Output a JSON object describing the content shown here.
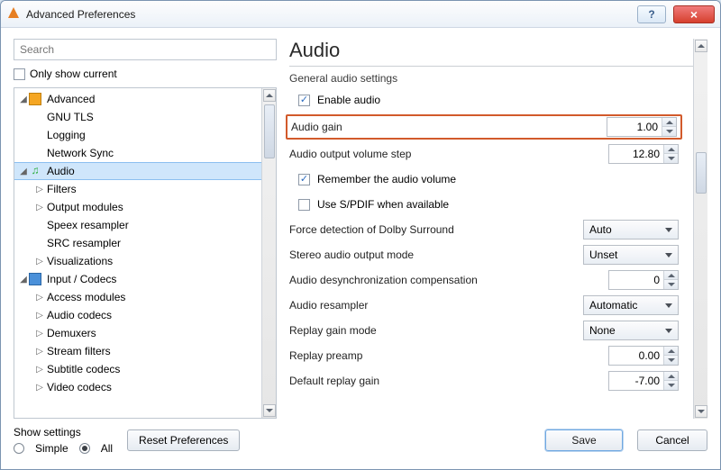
{
  "window": {
    "title": "Advanced Preferences"
  },
  "search": {
    "placeholder": "Search"
  },
  "only_current": {
    "label": "Only show current"
  },
  "tree": {
    "advanced": "Advanced",
    "gnu_tls": "GNU TLS",
    "logging": "Logging",
    "network_sync": "Network Sync",
    "audio": "Audio",
    "filters": "Filters",
    "output_modules": "Output modules",
    "speex": "Speex resampler",
    "src": "SRC resampler",
    "visualizations": "Visualizations",
    "input_codecs": "Input / Codecs",
    "access_modules": "Access modules",
    "audio_codecs": "Audio codecs",
    "demuxers": "Demuxers",
    "stream_filters": "Stream filters",
    "subtitle_codecs": "Subtitle codecs",
    "video_codecs": "Video codecs"
  },
  "panel": {
    "heading": "Audio",
    "subheading": "General audio settings",
    "enable_audio": "Enable audio",
    "audio_gain": {
      "label": "Audio gain",
      "value": "1.00"
    },
    "volume_step": {
      "label": "Audio output volume step",
      "value": "12.80"
    },
    "remember": "Remember the audio volume",
    "spdif": "Use S/PDIF when available",
    "dolby": {
      "label": "Force detection of Dolby Surround",
      "value": "Auto"
    },
    "stereo": {
      "label": "Stereo audio output mode",
      "value": "Unset"
    },
    "desync": {
      "label": "Audio desynchronization compensation",
      "value": "0"
    },
    "resampler": {
      "label": "Audio resampler",
      "value": "Automatic"
    },
    "rg_mode": {
      "label": "Replay gain mode",
      "value": "None"
    },
    "rg_preamp": {
      "label": "Replay preamp",
      "value": "0.00"
    },
    "rg_default": {
      "label": "Default replay gain",
      "value": "-7.00"
    }
  },
  "footer": {
    "show_settings": "Show settings",
    "simple": "Simple",
    "all": "All",
    "reset": "Reset Preferences",
    "save": "Save",
    "cancel": "Cancel"
  }
}
